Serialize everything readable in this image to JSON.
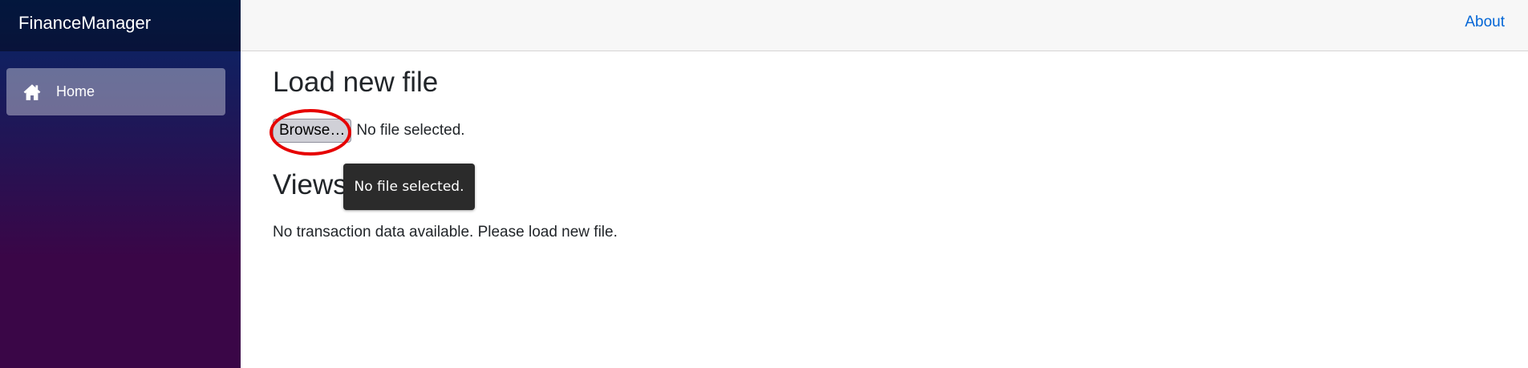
{
  "app": {
    "brand": "FinanceManager"
  },
  "sidebar": {
    "items": [
      {
        "label": "Home",
        "icon": "home-icon",
        "active": true
      }
    ]
  },
  "top_row": {
    "about_label": "About"
  },
  "main": {
    "load_heading": "Load new file",
    "browse_label": "Browse…",
    "file_status": "No file selected.",
    "views_heading": "Views",
    "tooltip_text": "No file selected.",
    "empty_message": "No transaction data available. Please load new file."
  },
  "colors": {
    "sidebar_gradient_top": "#052767",
    "sidebar_gradient_bottom": "#3a0647",
    "link": "#0366d6",
    "highlight": "#e60000",
    "tooltip_bg": "#2b2b2b"
  }
}
